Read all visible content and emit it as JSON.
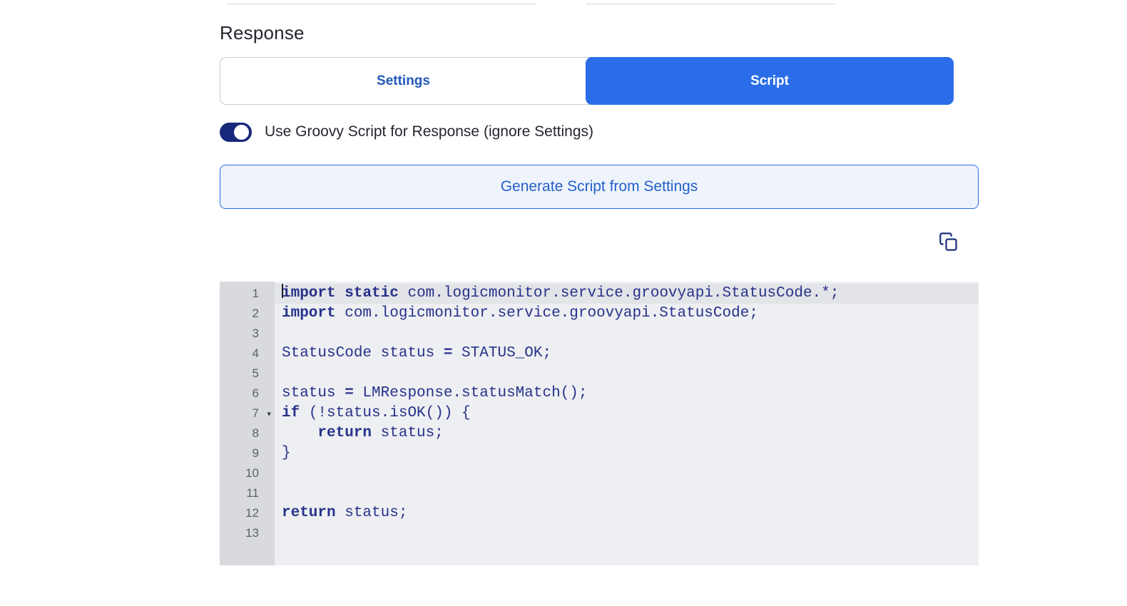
{
  "colors": {
    "accent_blue": "#2b6de8",
    "link_blue": "#2359b8",
    "navy": "#1b2d7b",
    "code_text": "#27328a",
    "gutter_bg": "#d8dade",
    "code_bg": "#edeff2",
    "active_line_bg": "#e3e4e8"
  },
  "response_section": {
    "title": "Response"
  },
  "tabs": {
    "settings": "Settings",
    "script": "Script",
    "active": "Script"
  },
  "toggle": {
    "label": "Use Groovy Script for Response (ignore Settings)",
    "state": "on"
  },
  "generate_button": {
    "label": "Generate Script from Settings"
  },
  "icons": {
    "copy": "copy-icon",
    "fold": "▾"
  },
  "editor": {
    "active_line": 1,
    "lines": [
      {
        "num": 1,
        "tokens": [
          {
            "t": "import",
            "b": true
          },
          {
            "t": " ",
            "b": false
          },
          {
            "t": "static",
            "b": true
          },
          {
            "t": " com.logicmonitor.service.groovyapi.StatusCode.*;",
            "b": false
          }
        ]
      },
      {
        "num": 2,
        "tokens": [
          {
            "t": "import",
            "b": true
          },
          {
            "t": " com.logicmonitor.service.groovyapi.StatusCode;",
            "b": false
          }
        ]
      },
      {
        "num": 3,
        "tokens": []
      },
      {
        "num": 4,
        "tokens": [
          {
            "t": "StatusCode status ",
            "b": false
          },
          {
            "t": "=",
            "b": true
          },
          {
            "t": " STATUS_OK;",
            "b": false
          }
        ]
      },
      {
        "num": 5,
        "tokens": []
      },
      {
        "num": 6,
        "tokens": [
          {
            "t": "status ",
            "b": false
          },
          {
            "t": "=",
            "b": true
          },
          {
            "t": " LMResponse.statusMatch();",
            "b": false
          }
        ]
      },
      {
        "num": 7,
        "fold": true,
        "tokens": [
          {
            "t": "if",
            "b": true
          },
          {
            "t": " (!status.isOK()) {",
            "b": false
          }
        ]
      },
      {
        "num": 8,
        "tokens": [
          {
            "t": "    ",
            "b": false
          },
          {
            "t": "return",
            "b": true
          },
          {
            "t": " status;",
            "b": false
          }
        ]
      },
      {
        "num": 9,
        "tokens": [
          {
            "t": "}",
            "b": false
          }
        ]
      },
      {
        "num": 10,
        "tokens": []
      },
      {
        "num": 11,
        "tokens": []
      },
      {
        "num": 12,
        "tokens": [
          {
            "t": "return",
            "b": true
          },
          {
            "t": " status;",
            "b": false
          }
        ]
      },
      {
        "num": 13,
        "tokens": []
      }
    ]
  }
}
